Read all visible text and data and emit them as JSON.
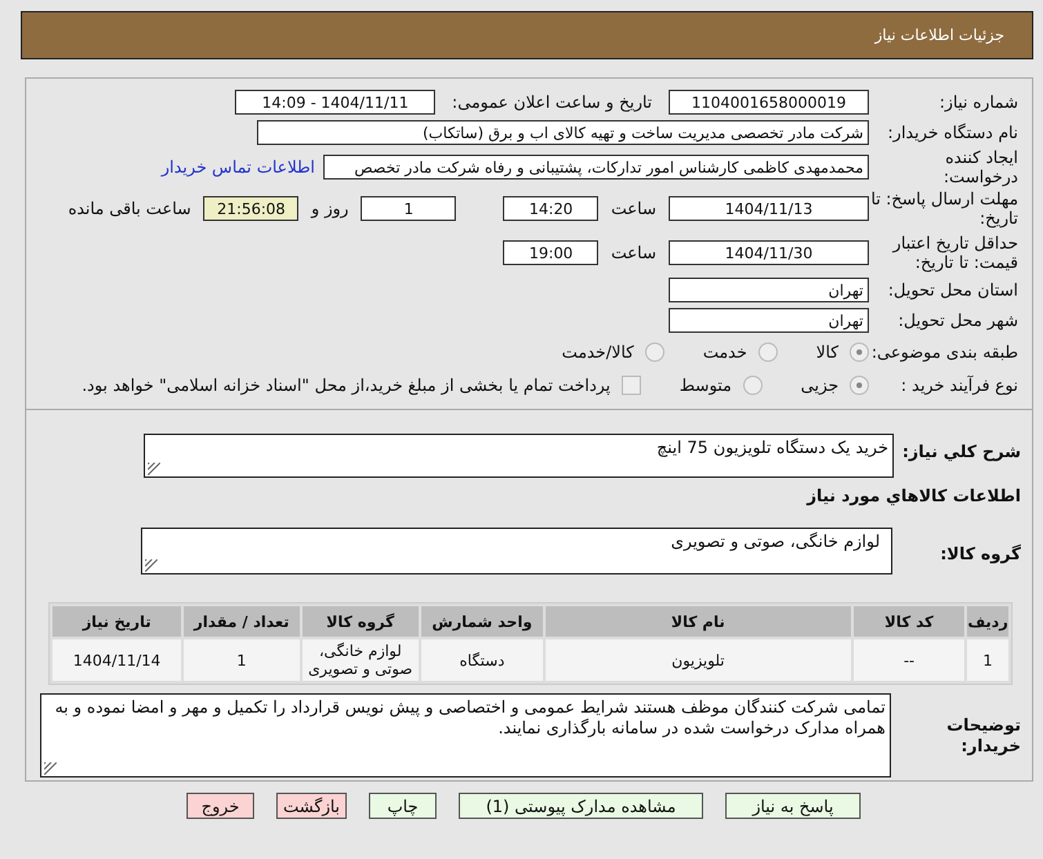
{
  "header": {
    "title": "جزئیات اطلاعات نیاز"
  },
  "form": {
    "rows": [
      {
        "label": "شماره نیاز:",
        "items": [
          {
            "kind": "field",
            "value": "1104001658000019"
          },
          {
            "kind": "label",
            "text": "تاریخ و ساعت اعلان عمومی:"
          },
          {
            "kind": "field",
            "value": "1404/11/11 - 14:09"
          }
        ]
      },
      {
        "label": "نام دستگاه خریدار:",
        "items": [
          {
            "kind": "long_field",
            "value": "شرکت مادر تخصصی مدیریت ساخت و تهیه کالای اب و برق (ساتکاب)"
          }
        ]
      },
      {
        "label": "ایجاد کننده درخواست:",
        "items": [
          {
            "kind": "medium_field",
            "value": "محمدمهدی کاظمی کارشناس امور تدارکات، پشتیبانی و رفاه شرکت مادر تخصص"
          },
          {
            "kind": "link",
            "text": "اطلاعات تماس خریدار"
          }
        ]
      },
      {
        "label": "مهلت ارسال پاسخ: تا تاریخ:",
        "items": [
          {
            "kind": "field",
            "value": "1404/11/13"
          },
          {
            "kind": "label",
            "text": "ساعت"
          },
          {
            "kind": "time_field",
            "value": "14:20"
          },
          {
            "kind": "gap"
          },
          {
            "kind": "time_field",
            "value": "1"
          },
          {
            "kind": "label",
            "text": "روز و"
          },
          {
            "kind": "countdown",
            "value": "21:56:08"
          },
          {
            "kind": "label",
            "text": "ساعت باقی مانده"
          }
        ]
      },
      {
        "label": "حداقل تاریخ اعتبار قیمت: تا تاریخ:",
        "items": [
          {
            "kind": "field",
            "value": "1404/11/30"
          },
          {
            "kind": "label",
            "text": "ساعت"
          },
          {
            "kind": "time_field",
            "value": "19:00"
          }
        ]
      },
      {
        "label": "استان محل تحویل:",
        "items": [
          {
            "kind": "field",
            "value": "تهران"
          }
        ]
      },
      {
        "label": "شهر محل تحویل:",
        "items": [
          {
            "kind": "field",
            "value": "تهران"
          }
        ]
      },
      {
        "label": "طبقه بندی موضوعی:",
        "items": [
          {
            "kind": "radio",
            "text": "کالا",
            "selected": true,
            "disabled": true
          },
          {
            "kind": "radio",
            "text": "خدمت",
            "selected": false,
            "disabled": true
          },
          {
            "kind": "radio",
            "text": "کالا/خدمت",
            "selected": false,
            "disabled": true
          }
        ]
      },
      {
        "label": "نوع فرآیند خرید :",
        "items": [
          {
            "kind": "radio",
            "text": "جزیی",
            "selected": true,
            "disabled": true
          },
          {
            "kind": "radio",
            "text": "متوسط",
            "selected": false,
            "disabled": true
          },
          {
            "kind": "checkbox",
            "text": "پرداخت تمام یا بخشی از مبلغ خرید،از محل \"اسناد خزانه اسلامی\" خواهد بود.",
            "checked": false,
            "disabled": true
          }
        ]
      }
    ]
  },
  "summary": {
    "label": "شرح کلي نياز:",
    "value": "خرید یک دستگاه تلویزیون 75 اینچ"
  },
  "goods_heading": "اطلاعات کالاهاي مورد نياز",
  "goods_group": {
    "label": "گروه کالا:",
    "value": "لوازم خانگی، صوتی و تصویری"
  },
  "table": {
    "columns": [
      "ردیف",
      "کد کالا",
      "نام کالا",
      "واحد شمارش",
      "گروه کالا",
      "تعداد / مقدار",
      "تاریخ نیاز"
    ],
    "rows": [
      [
        "1",
        "--",
        "تلویزیون",
        "دستگاه",
        "لوازم خانگی، صوتی و تصویری",
        "1",
        "1404/11/14"
      ]
    ]
  },
  "buyer_notes": {
    "label": "توضیحات خریدار:",
    "value": "تمامی شرکت کنندگان موظف هستند شرایط عمومی و اختصاصی و پیش نویس قرارداد را تکمیل و مهر و امضا نموده و به همراه مدارک درخواست شده در سامانه بارگذاری نمایند."
  },
  "buttons": [
    {
      "label": "پاسخ به نیاز",
      "kind": "action"
    },
    {
      "label": "مشاهده مدارک پیوستی (1)",
      "kind": "action"
    },
    {
      "label": "چاپ",
      "kind": "action"
    },
    {
      "label": "بازگشت",
      "kind": "exit"
    },
    {
      "label": "خروج",
      "kind": "exit"
    }
  ]
}
